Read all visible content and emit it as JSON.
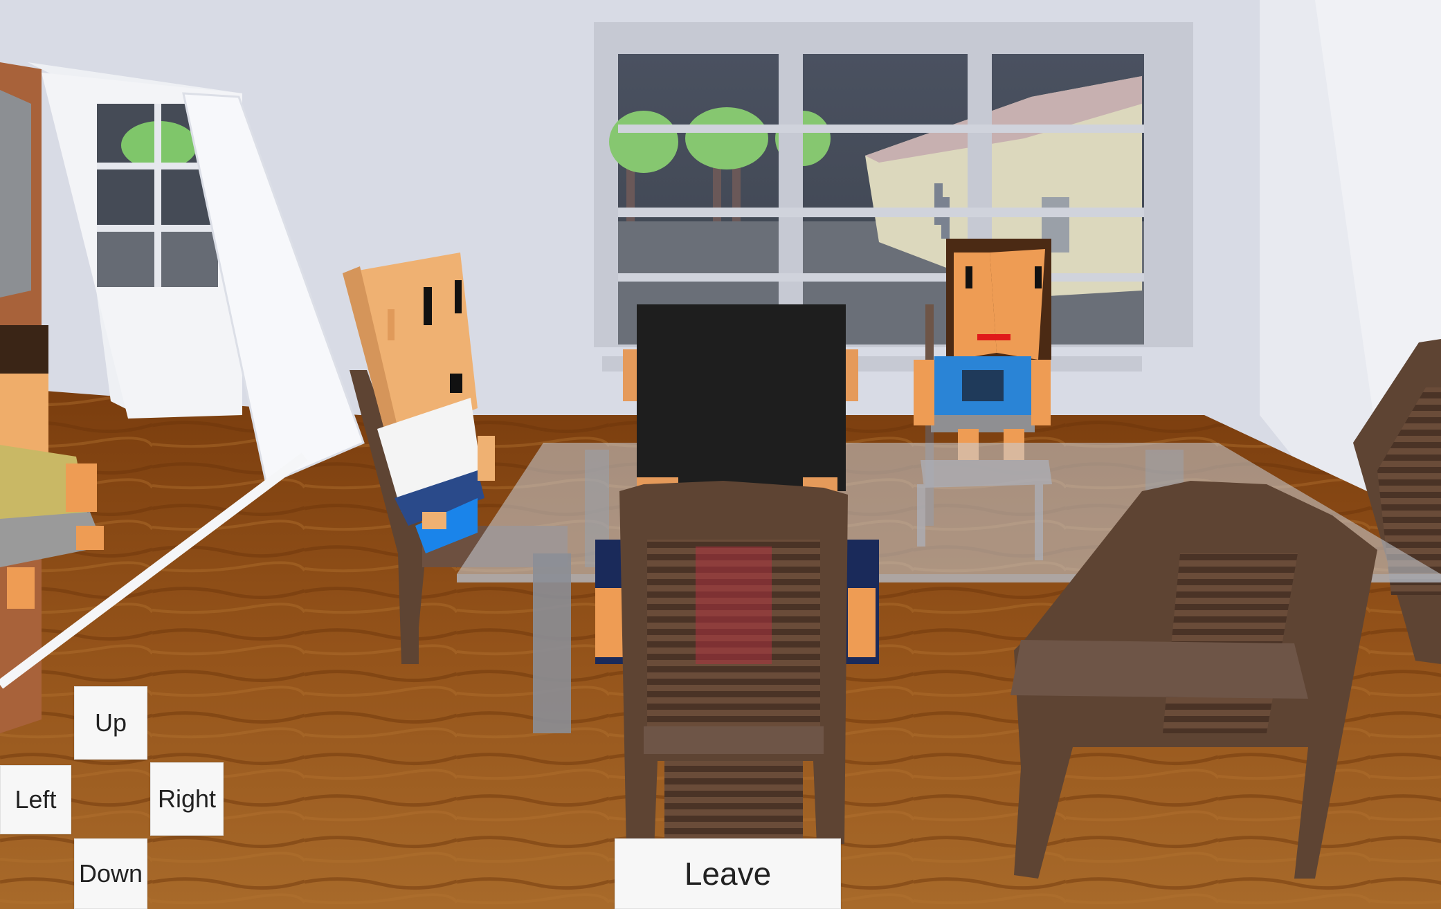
{
  "controls": {
    "up_label": "Up",
    "left_label": "Left",
    "right_label": "Right",
    "down_label": "Down",
    "leave_label": "Leave"
  },
  "scene": {
    "setting": "dining-room",
    "colors": {
      "wall": "#d9dbe5",
      "floor": "#8a4a16",
      "sky": "#4e5561",
      "window_frame": "#e9eaf0",
      "chair_wood": "#5e4433",
      "table_glass": "#c9cfd8"
    },
    "characters": [
      {
        "name": "man-white-shirt",
        "shirt_color": "#f4f4f4",
        "skin_color": "#efb172"
      },
      {
        "name": "player-back-view",
        "hair_color": "#1e1e1e",
        "shirt_color": "#1a2a5a"
      },
      {
        "name": "woman-blue-shirt",
        "hair_color": "#4b2a14",
        "shirt_color": "#2a84d6",
        "skin_color": "#ee9c54"
      },
      {
        "name": "woman-yellow-shirt",
        "shirt_color": "#c9b865"
      }
    ]
  }
}
